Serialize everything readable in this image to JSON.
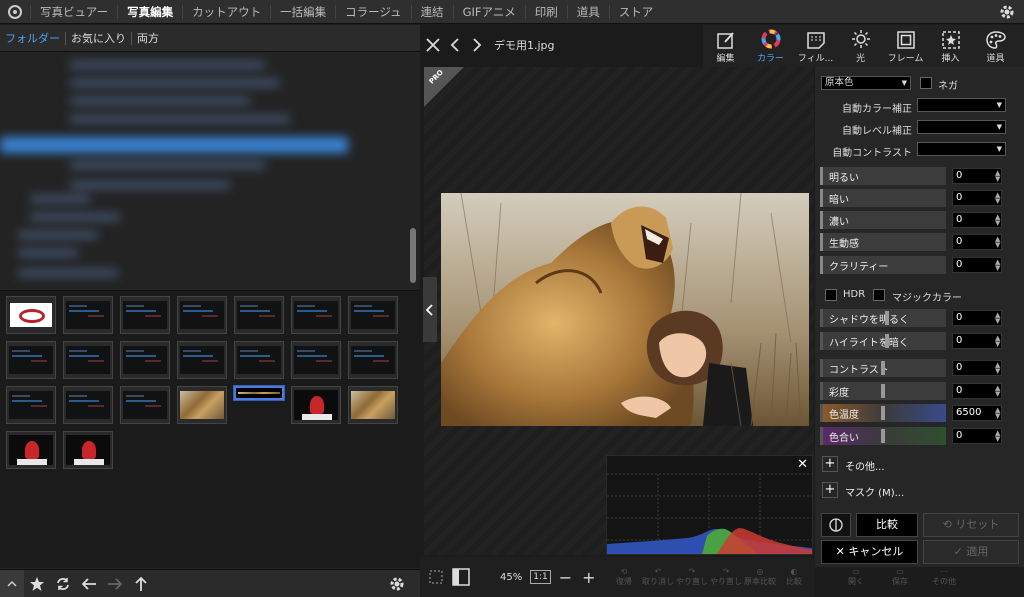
{
  "menu": {
    "tabs": [
      "写真ビュアー",
      "写真編集",
      "カットアウト",
      "一括編集",
      "コラージュ",
      "連結",
      "GIFアニメ",
      "印刷",
      "道具",
      "ストア"
    ],
    "active": "写真編集"
  },
  "left": {
    "tabs": [
      "フォルダー",
      "お気に入り",
      "両方"
    ]
  },
  "center": {
    "filename": "デモ用1.jpg",
    "pro_badge": "PRO",
    "zoom": "45%",
    "one_to_one": "1:1"
  },
  "right_toolbar": {
    "items": [
      {
        "label": "編集",
        "icon": "edit-icon"
      },
      {
        "label": "カラー",
        "icon": "color-wheel-icon"
      },
      {
        "label": "フィル...",
        "icon": "filter-icon"
      },
      {
        "label": "光",
        "icon": "sun-icon"
      },
      {
        "label": "フレーム",
        "icon": "frame-icon"
      },
      {
        "label": "挿入",
        "icon": "insert-icon"
      },
      {
        "label": "道具",
        "icon": "palette-icon"
      }
    ]
  },
  "color_panel": {
    "preset": "原本色",
    "negative_label": "ネガ",
    "auto_color_label": "自動カラー補正",
    "auto_level_label": "自動レベル補正",
    "auto_contrast_label": "自動コントラスト",
    "sliders": [
      {
        "label": "明るい",
        "value": "0"
      },
      {
        "label": "暗い",
        "value": "0"
      },
      {
        "label": "濃い",
        "value": "0"
      },
      {
        "label": "生動感",
        "value": "0"
      },
      {
        "label": "クラリティー",
        "value": "0"
      }
    ],
    "hdr_label": "HDR",
    "magic_label": "マジックカラー",
    "sliders2": [
      {
        "label": "シャドウを明るく",
        "value": "0"
      },
      {
        "label": "ハイライトを暗く",
        "value": "0"
      }
    ],
    "sliders3": [
      {
        "label": "コントラスト",
        "value": "0"
      },
      {
        "label": "彩度",
        "value": "0"
      },
      {
        "label": "色温度",
        "value": "6500"
      },
      {
        "label": "色合い",
        "value": "0"
      }
    ],
    "more_label": "その他...",
    "mask_label": "マスク (M)...",
    "compare_label": "比較",
    "reset_label": "リセット",
    "cancel_label": "キャンセル",
    "apply_label": "適用"
  },
  "bottom_actions": [
    "復帰",
    "取り消し",
    "やり直し",
    "やり直し",
    "原本比較",
    "比較",
    "開く",
    "保存",
    "その他"
  ]
}
